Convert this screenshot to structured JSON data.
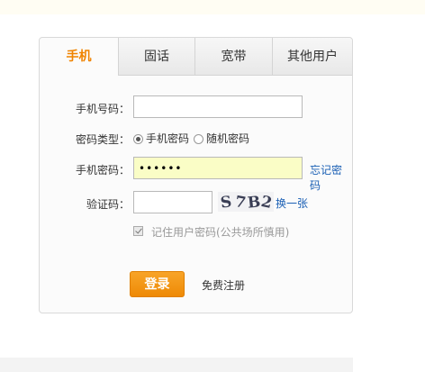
{
  "tabs": [
    {
      "label": "手机",
      "active": true
    },
    {
      "label": "固话",
      "active": false
    },
    {
      "label": "宽带",
      "active": false
    },
    {
      "label": "其他用户",
      "active": false
    }
  ],
  "form": {
    "phone_label": "手机号码：",
    "phone_value": "",
    "pwd_type_label": "密码类型：",
    "pwd_type_options": [
      {
        "label": "手机密码",
        "selected": true
      },
      {
        "label": "随机密码",
        "selected": false
      }
    ],
    "pwd_label": "手机密码：",
    "pwd_value": "••••••",
    "forgot_link": "忘记密码",
    "captcha_label": "验证码：",
    "captcha_value": "",
    "captcha_chars": [
      "S",
      "7",
      "B",
      "2"
    ],
    "refresh_link": "换一张",
    "remember_label": "记住用户密码(公共场所慎用)",
    "remember_checked": true,
    "login_button": "登录",
    "register_link": "免费注册"
  },
  "colors": {
    "accent": "#f08300",
    "link": "#1a5fb4",
    "password_bg": "#fafdc6"
  }
}
